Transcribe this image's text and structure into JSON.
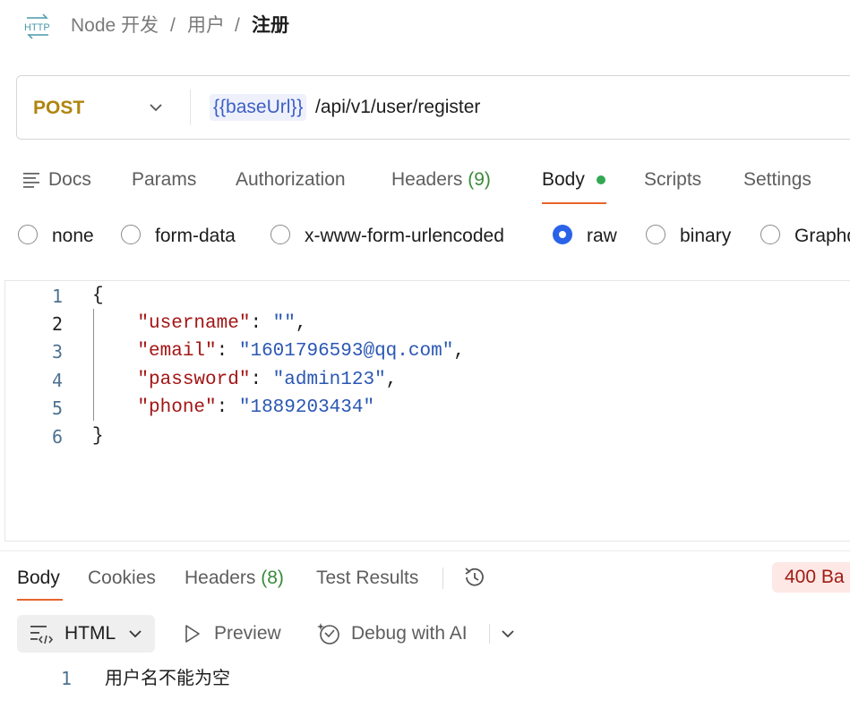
{
  "breadcrumb": {
    "collection": "Node 开发",
    "folder": "用户",
    "current": "注册",
    "separator": "/",
    "icon": "http-icon"
  },
  "request": {
    "method": "POST",
    "url_variable": "{{baseUrl}}",
    "url_path": "/api/v1/user/register"
  },
  "request_tabs": {
    "docs": "Docs",
    "params": "Params",
    "authorization": "Authorization",
    "headers_label": "Headers",
    "headers_count": "(9)",
    "body": "Body",
    "scripts": "Scripts",
    "settings": "Settings",
    "active": "Body"
  },
  "body_types": {
    "none": "none",
    "form_data": "form-data",
    "urlencoded": "x-www-form-urlencoded",
    "raw": "raw",
    "binary": "binary",
    "graphql": "Graphq",
    "selected": "raw"
  },
  "editor": {
    "line_numbers": [
      "1",
      "2",
      "3",
      "4",
      "5",
      "6"
    ],
    "open_brace": "{",
    "close_brace": "}",
    "fields": [
      {
        "key": "\"username\"",
        "value": "\"\""
      },
      {
        "key": "\"email\"",
        "value": "\"1601796593@qq.com\""
      },
      {
        "key": "\"password\"",
        "value": "\"admin123\""
      },
      {
        "key": "\"phone\"",
        "value": "\"1889203434\""
      }
    ]
  },
  "response": {
    "tabs": {
      "body": "Body",
      "cookies": "Cookies",
      "headers_label": "Headers",
      "headers_count": "(8)",
      "test_results": "Test Results"
    },
    "status": "400 Ba",
    "format": "HTML",
    "preview": "Preview",
    "debug": "Debug with AI",
    "line_number": "1",
    "text": "用户名不能为空"
  },
  "colors": {
    "method": "#b0850f",
    "accent": "#e8652c",
    "radio_selected": "#2a63e8",
    "json_key": "#a31515",
    "json_value": "#2a57b3",
    "status_error_bg": "#fde8e6",
    "status_error_text": "#a01c12"
  }
}
